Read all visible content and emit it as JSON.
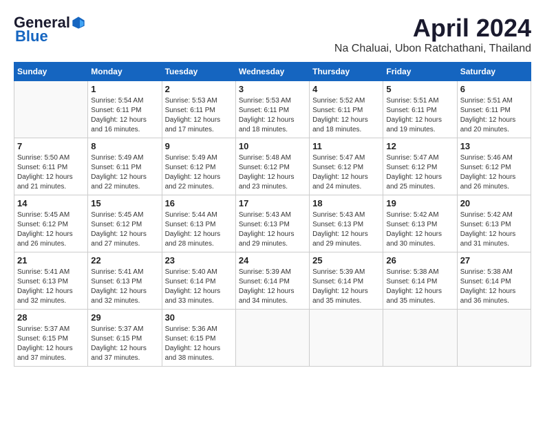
{
  "header": {
    "logo_general": "General",
    "logo_blue": "Blue",
    "month": "April 2024",
    "location": "Na Chaluai, Ubon Ratchathani, Thailand"
  },
  "weekdays": [
    "Sunday",
    "Monday",
    "Tuesday",
    "Wednesday",
    "Thursday",
    "Friday",
    "Saturday"
  ],
  "days": [
    {
      "date": "",
      "info": ""
    },
    {
      "date": "1",
      "info": "Sunrise: 5:54 AM\nSunset: 6:11 PM\nDaylight: 12 hours\nand 16 minutes."
    },
    {
      "date": "2",
      "info": "Sunrise: 5:53 AM\nSunset: 6:11 PM\nDaylight: 12 hours\nand 17 minutes."
    },
    {
      "date": "3",
      "info": "Sunrise: 5:53 AM\nSunset: 6:11 PM\nDaylight: 12 hours\nand 18 minutes."
    },
    {
      "date": "4",
      "info": "Sunrise: 5:52 AM\nSunset: 6:11 PM\nDaylight: 12 hours\nand 18 minutes."
    },
    {
      "date": "5",
      "info": "Sunrise: 5:51 AM\nSunset: 6:11 PM\nDaylight: 12 hours\nand 19 minutes."
    },
    {
      "date": "6",
      "info": "Sunrise: 5:51 AM\nSunset: 6:11 PM\nDaylight: 12 hours\nand 20 minutes."
    },
    {
      "date": "7",
      "info": "Sunrise: 5:50 AM\nSunset: 6:11 PM\nDaylight: 12 hours\nand 21 minutes."
    },
    {
      "date": "8",
      "info": "Sunrise: 5:49 AM\nSunset: 6:11 PM\nDaylight: 12 hours\nand 22 minutes."
    },
    {
      "date": "9",
      "info": "Sunrise: 5:49 AM\nSunset: 6:12 PM\nDaylight: 12 hours\nand 22 minutes."
    },
    {
      "date": "10",
      "info": "Sunrise: 5:48 AM\nSunset: 6:12 PM\nDaylight: 12 hours\nand 23 minutes."
    },
    {
      "date": "11",
      "info": "Sunrise: 5:47 AM\nSunset: 6:12 PM\nDaylight: 12 hours\nand 24 minutes."
    },
    {
      "date": "12",
      "info": "Sunrise: 5:47 AM\nSunset: 6:12 PM\nDaylight: 12 hours\nand 25 minutes."
    },
    {
      "date": "13",
      "info": "Sunrise: 5:46 AM\nSunset: 6:12 PM\nDaylight: 12 hours\nand 26 minutes."
    },
    {
      "date": "14",
      "info": "Sunrise: 5:45 AM\nSunset: 6:12 PM\nDaylight: 12 hours\nand 26 minutes."
    },
    {
      "date": "15",
      "info": "Sunrise: 5:45 AM\nSunset: 6:12 PM\nDaylight: 12 hours\nand 27 minutes."
    },
    {
      "date": "16",
      "info": "Sunrise: 5:44 AM\nSunset: 6:13 PM\nDaylight: 12 hours\nand 28 minutes."
    },
    {
      "date": "17",
      "info": "Sunrise: 5:43 AM\nSunset: 6:13 PM\nDaylight: 12 hours\nand 29 minutes."
    },
    {
      "date": "18",
      "info": "Sunrise: 5:43 AM\nSunset: 6:13 PM\nDaylight: 12 hours\nand 29 minutes."
    },
    {
      "date": "19",
      "info": "Sunrise: 5:42 AM\nSunset: 6:13 PM\nDaylight: 12 hours\nand 30 minutes."
    },
    {
      "date": "20",
      "info": "Sunrise: 5:42 AM\nSunset: 6:13 PM\nDaylight: 12 hours\nand 31 minutes."
    },
    {
      "date": "21",
      "info": "Sunrise: 5:41 AM\nSunset: 6:13 PM\nDaylight: 12 hours\nand 32 minutes."
    },
    {
      "date": "22",
      "info": "Sunrise: 5:41 AM\nSunset: 6:13 PM\nDaylight: 12 hours\nand 32 minutes."
    },
    {
      "date": "23",
      "info": "Sunrise: 5:40 AM\nSunset: 6:14 PM\nDaylight: 12 hours\nand 33 minutes."
    },
    {
      "date": "24",
      "info": "Sunrise: 5:39 AM\nSunset: 6:14 PM\nDaylight: 12 hours\nand 34 minutes."
    },
    {
      "date": "25",
      "info": "Sunrise: 5:39 AM\nSunset: 6:14 PM\nDaylight: 12 hours\nand 35 minutes."
    },
    {
      "date": "26",
      "info": "Sunrise: 5:38 AM\nSunset: 6:14 PM\nDaylight: 12 hours\nand 35 minutes."
    },
    {
      "date": "27",
      "info": "Sunrise: 5:38 AM\nSunset: 6:14 PM\nDaylight: 12 hours\nand 36 minutes."
    },
    {
      "date": "28",
      "info": "Sunrise: 5:37 AM\nSunset: 6:15 PM\nDaylight: 12 hours\nand 37 minutes."
    },
    {
      "date": "29",
      "info": "Sunrise: 5:37 AM\nSunset: 6:15 PM\nDaylight: 12 hours\nand 37 minutes."
    },
    {
      "date": "30",
      "info": "Sunrise: 5:36 AM\nSunset: 6:15 PM\nDaylight: 12 hours\nand 38 minutes."
    },
    {
      "date": "",
      "info": ""
    },
    {
      "date": "",
      "info": ""
    },
    {
      "date": "",
      "info": ""
    },
    {
      "date": "",
      "info": ""
    }
  ]
}
